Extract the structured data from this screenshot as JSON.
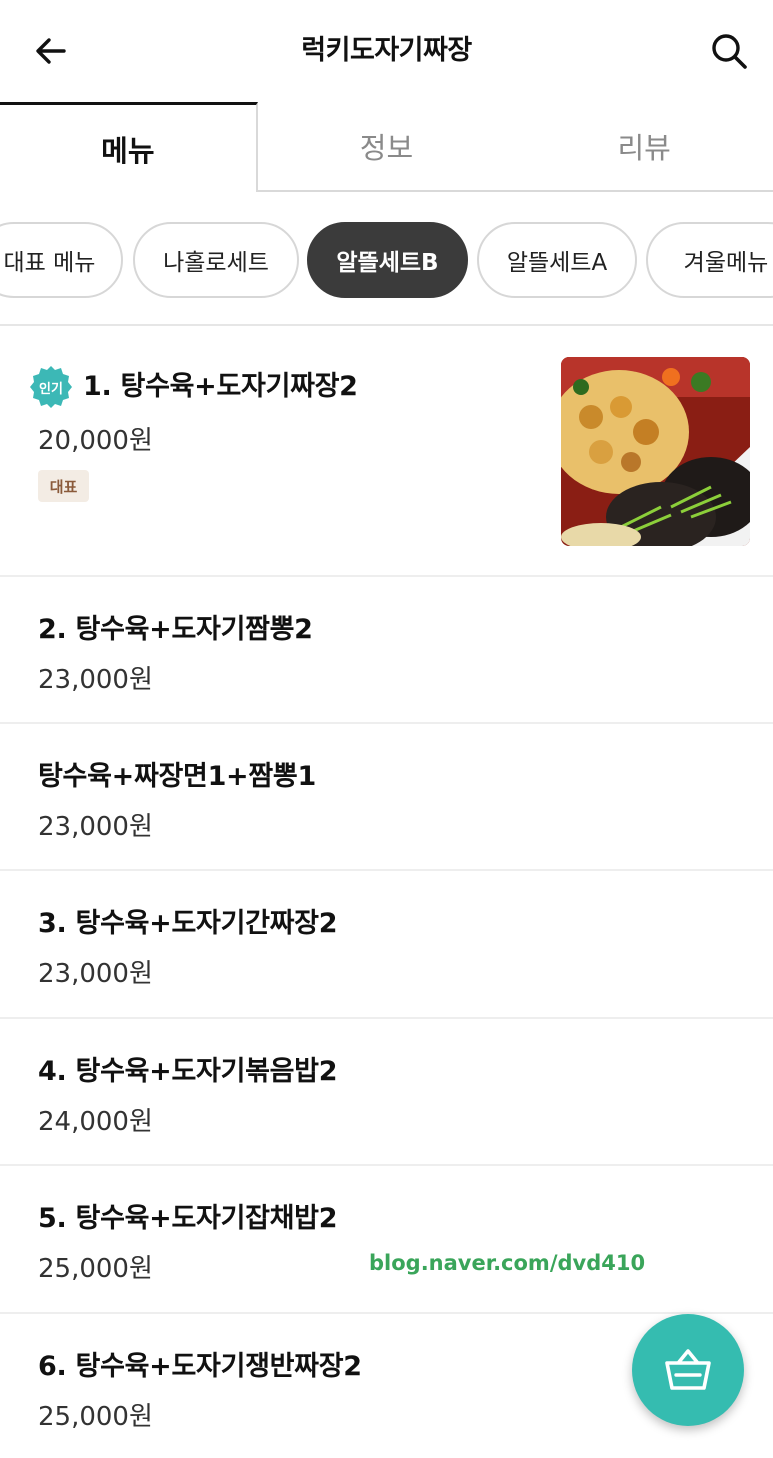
{
  "header": {
    "title": "럭키도자기짜장",
    "back_icon": "arrow-left-icon",
    "search_icon": "search-icon"
  },
  "tabs": [
    {
      "label": "메뉴",
      "active": true
    },
    {
      "label": "정보",
      "active": false
    },
    {
      "label": "리뷰",
      "active": false
    }
  ],
  "categories": [
    {
      "label": "대표 메뉴",
      "active": false
    },
    {
      "label": "나홀로세트",
      "active": false
    },
    {
      "label": "알뜰세트B",
      "active": true
    },
    {
      "label": "알뜰세트A",
      "active": false
    },
    {
      "label": "겨울메뉴",
      "active": false
    }
  ],
  "menu_items": [
    {
      "name": "1. 탕수육+도자기짜장2",
      "price": "20,000원",
      "badge": "인기",
      "tag": "대표",
      "has_image": true
    },
    {
      "name": "2. 탕수육+도자기짬뽕2",
      "price": "23,000원"
    },
    {
      "name": "탕수육+짜장면1+짬뽕1",
      "price": "23,000원"
    },
    {
      "name": "3. 탕수육+도자기간짜장2",
      "price": "23,000원"
    },
    {
      "name": "4. 탕수육+도자기볶음밥2",
      "price": "24,000원"
    },
    {
      "name": "5. 탕수육+도자기잡채밥2",
      "price": "25,000원"
    },
    {
      "name": "6. 탕수육+도자기쟁반짜장2",
      "price": "25,000원"
    }
  ],
  "watermark": "blog.naver.com/dvd410",
  "cart": {
    "icon": "basket-icon"
  },
  "colors": {
    "accent": "#35bcb0",
    "active_chip": "#3b3b3b",
    "badge": "#3cb8b6",
    "watermark": "#3aa55a"
  }
}
